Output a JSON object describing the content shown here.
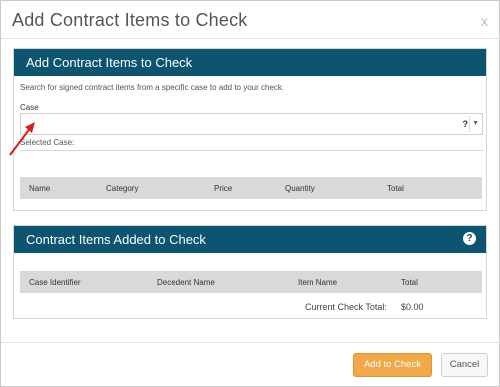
{
  "modal": {
    "title": "Add Contract Items to Check",
    "close_label": "x"
  },
  "add_panel": {
    "title": "Add Contract Items to Check",
    "description": "Search for signed contract items from a specific case to add to your check.",
    "case_label": "Case",
    "case_value": "",
    "help_glyph": "?",
    "selected_case_label": "Selected Case:",
    "columns": [
      "Name",
      "Category",
      "Price",
      "Quantity",
      "Total"
    ]
  },
  "added_panel": {
    "title": "Contract Items Added to Check",
    "columns": [
      "Case Identifier",
      "Decedent Name",
      "Item Name",
      "Total"
    ],
    "current_total_label": "Current Check Total:",
    "current_total_value": "$0.00"
  },
  "footer": {
    "add_button": "Add to Check",
    "cancel_button": "Cancel"
  },
  "colors": {
    "panel_header": "#0c5470",
    "primary_button": "#f0a848",
    "annotation_arrow": "#d62020"
  },
  "icons": [
    "close-icon",
    "help-icon",
    "chevron-down-icon",
    "annotation-arrow-icon"
  ]
}
